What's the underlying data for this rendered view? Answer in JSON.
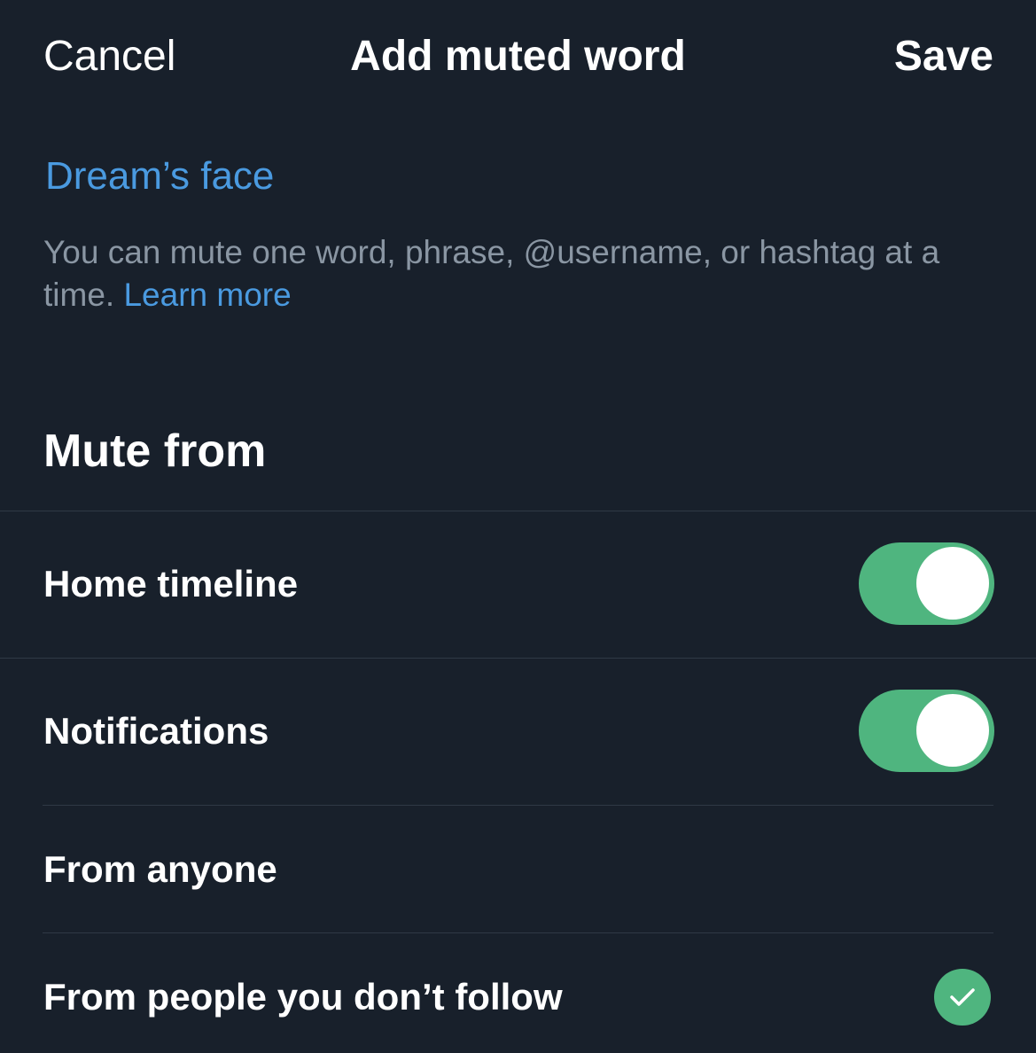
{
  "nav": {
    "cancel_label": "Cancel",
    "title": "Add muted word",
    "save_label": "Save"
  },
  "muted_word": {
    "value": "Dream’s face"
  },
  "help": {
    "text": "You can mute one word, phrase, @username, or hashtag at a time. ",
    "link_label": "Learn more"
  },
  "mute_from": {
    "title": "Mute from",
    "options": [
      {
        "label": "Home timeline",
        "enabled": true
      },
      {
        "label": "Notifications",
        "enabled": true
      }
    ]
  },
  "audience": {
    "options": [
      {
        "label": "From anyone",
        "selected": false
      },
      {
        "label": "From people you don’t follow",
        "selected": true
      }
    ]
  },
  "colors": {
    "background": "#18202b",
    "accent_link": "#4a9ae0",
    "toggle_on": "#4fb57f",
    "secondary_text": "#8a96a3",
    "divider": "#2f3945"
  },
  "icons": {
    "selected_indicator": "checkmark-icon"
  }
}
